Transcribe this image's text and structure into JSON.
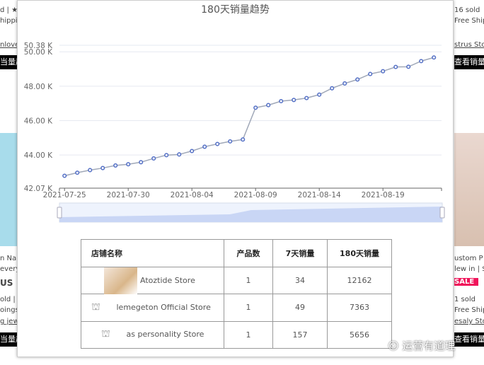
{
  "background": {
    "left": [
      "d | ★",
      "hippi",
      "nlove",
      "当量趋",
      "n Nar",
      "every",
      "US",
      "old |",
      "oings",
      "g jew",
      "当量趋"
    ],
    "right": [
      "16 sold",
      "Free Ship",
      "strus Sto",
      "查看销量",
      "ustom P",
      "lew in | $",
      "SALE",
      "1 sold",
      "Free Ship",
      "esaly Sto",
      "查看销量"
    ]
  },
  "modal": {
    "chart_data": {
      "type": "line",
      "title": "180天销量趋势",
      "xlabel": "",
      "ylabel": "",
      "ylim": [
        42.07,
        50.38
      ],
      "y_ticks": [
        "42.07 K",
        "44.00 K",
        "46.00 K",
        "48.00 K",
        "50.00 K",
        "50.38 K"
      ],
      "y_tick_values": [
        42.07,
        44,
        46,
        48,
        50,
        50.38
      ],
      "x_ticks": [
        "2021-07-25",
        "2021-07-30",
        "2021-08-04",
        "2021-08-09",
        "2021-08-14",
        "2021-08-19"
      ],
      "x_start": "2021-07-25",
      "values": [
        42.79,
        42.97,
        43.12,
        43.24,
        43.39,
        43.46,
        43.58,
        43.8,
        43.99,
        44.03,
        44.23,
        44.48,
        44.64,
        44.79,
        44.9,
        46.75,
        46.9,
        47.13,
        47.2,
        47.31,
        47.51,
        47.88,
        48.16,
        48.39,
        48.71,
        48.87,
        49.12,
        49.13,
        49.46,
        49.67
      ],
      "unit": "K",
      "grid": true,
      "line_color": "#a0a8b8",
      "marker_color": "#5470c6"
    },
    "table": {
      "headers": [
        "店铺名称",
        "产品数",
        "7天销量",
        "180天销量"
      ],
      "rows": [
        {
          "store": "Atoztide Store",
          "products": "1",
          "sales7": "34",
          "sales180": "12162",
          "icon": "store-thumbnail"
        },
        {
          "store": "lemegeton Official Store",
          "products": "1",
          "sales7": "49",
          "sales180": "7363",
          "icon": "store-icon"
        },
        {
          "store": "as personality Store",
          "products": "1",
          "sales7": "157",
          "sales180": "5656",
          "icon": "store-icon"
        }
      ]
    }
  },
  "watermark": "运营有道理"
}
